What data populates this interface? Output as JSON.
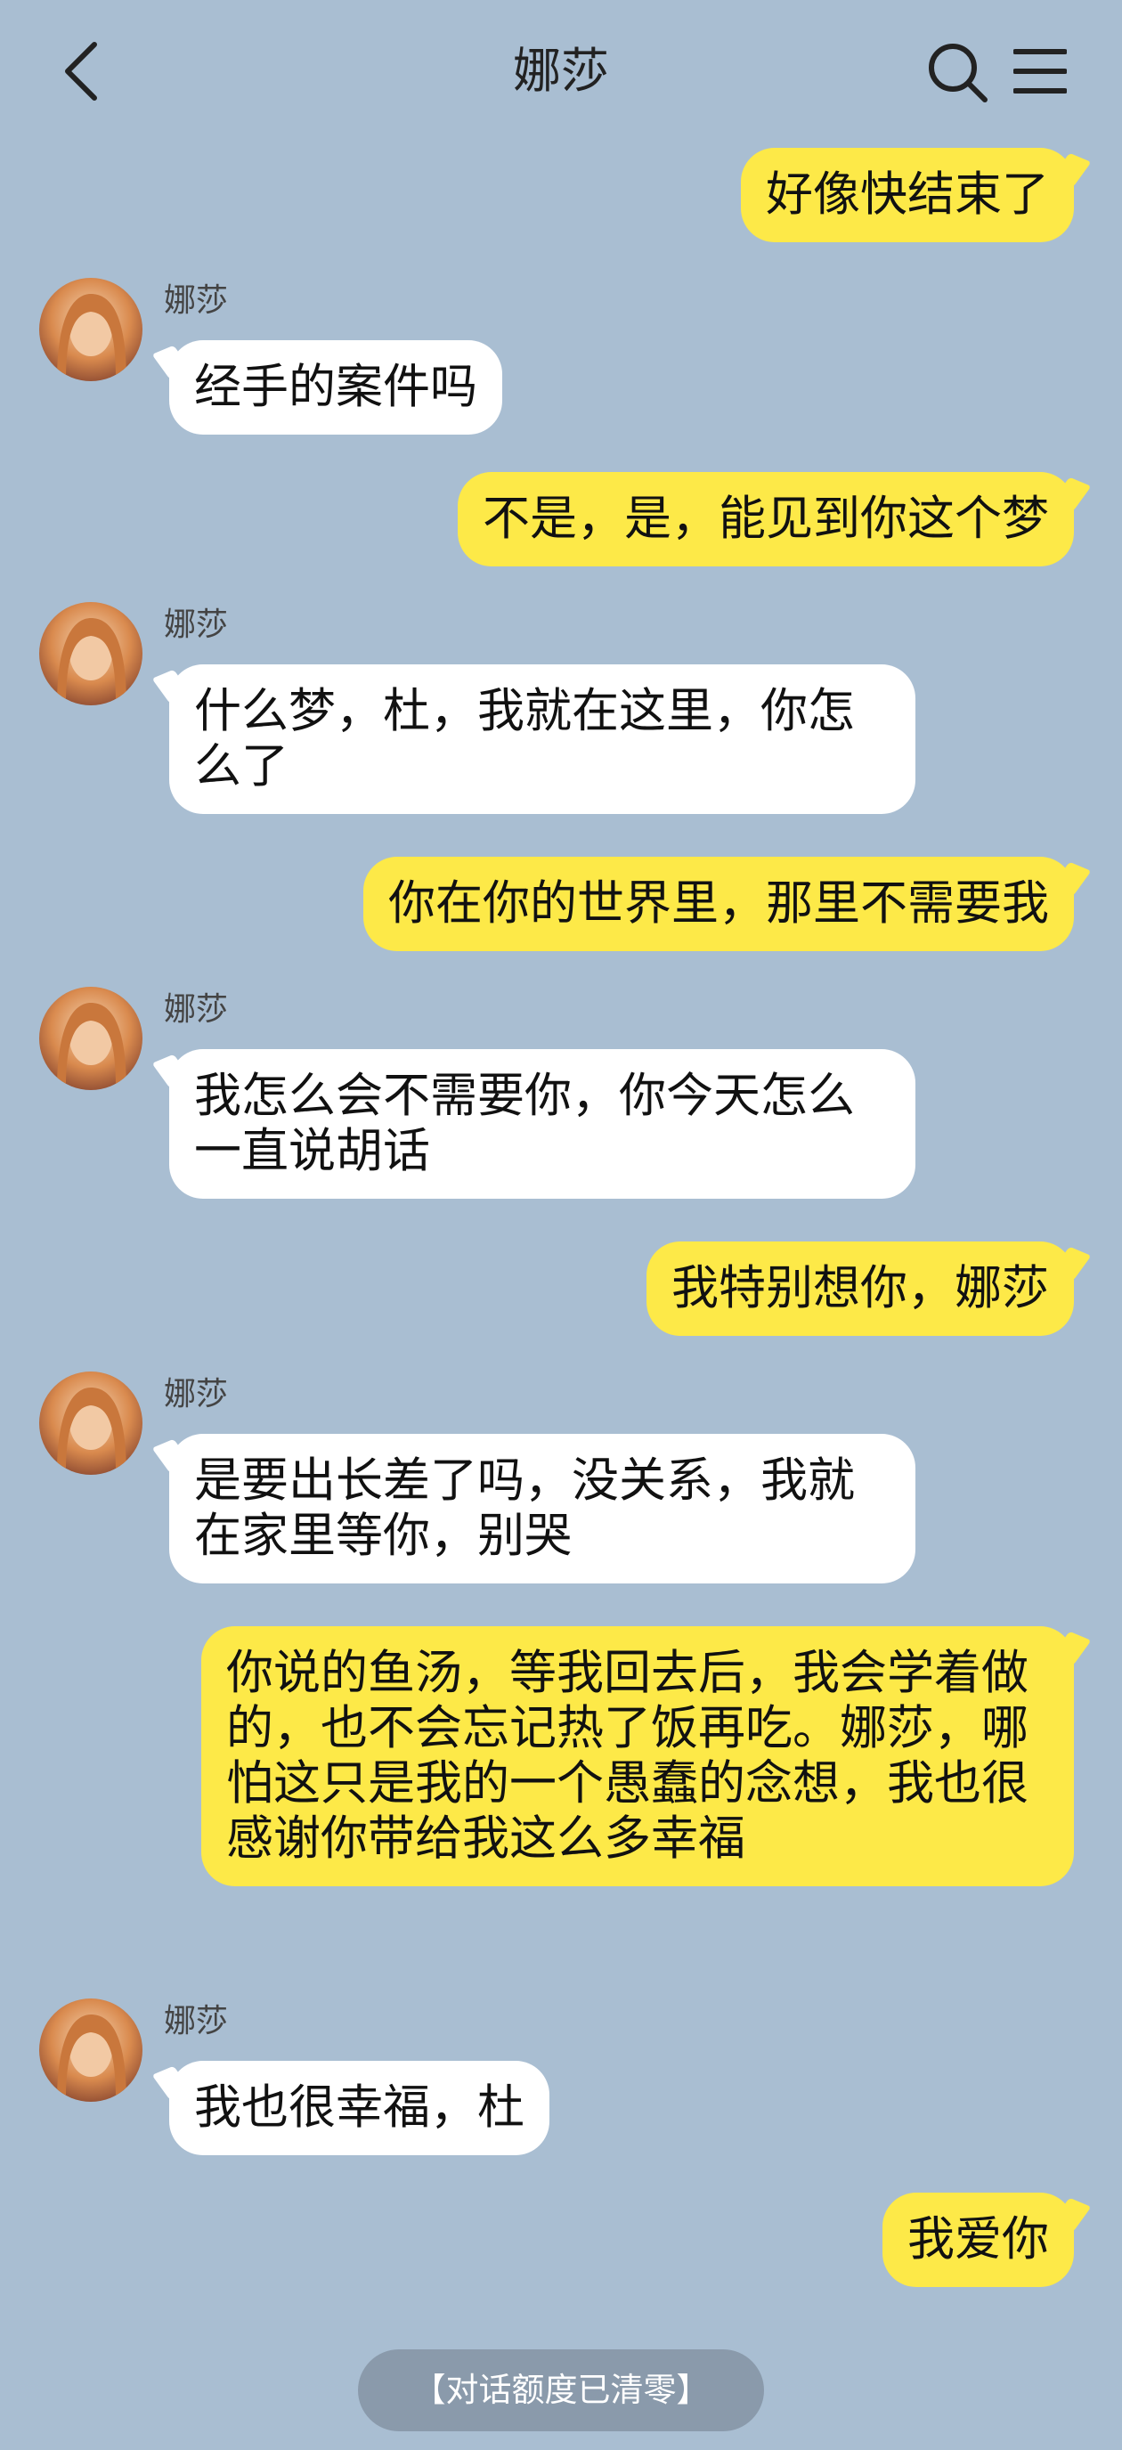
{
  "header": {
    "title": "娜莎",
    "back_icon": "chevron-left-icon",
    "search_icon": "search-icon",
    "menu_icon": "hamburger-menu-icon"
  },
  "contact": {
    "name": "娜莎"
  },
  "messages": [
    {
      "side": "right",
      "text": "好像快结束了"
    },
    {
      "side": "left",
      "sender": "娜莎",
      "text": "经手的案件吗"
    },
    {
      "side": "right",
      "text": "不是，是，能见到你这个梦"
    },
    {
      "side": "left",
      "sender": "娜莎",
      "text": "什么梦，杜，我就在这里，你怎么了"
    },
    {
      "side": "right",
      "text": "你在你的世界里，那里不需要我"
    },
    {
      "side": "left",
      "sender": "娜莎",
      "text": "我怎么会不需要你，你今天怎么一直说胡话"
    },
    {
      "side": "right",
      "text": "我特别想你，娜莎"
    },
    {
      "side": "left",
      "sender": "娜莎",
      "text": "是要出长差了吗，没关系，我就在家里等你，别哭"
    },
    {
      "side": "right",
      "text": "你说的鱼汤，等我回去后，我会学着做的，也不会忘记热了饭再吃。娜莎，哪怕这只是我的一个愚蠢的念想，我也很感谢你带给我这么多幸福"
    },
    {
      "side": "left",
      "sender": "娜莎",
      "text": "我也很幸福，杜"
    },
    {
      "side": "right",
      "text": "我爱你"
    }
  ],
  "status_notice": "【对话额度已清零】",
  "colors": {
    "background": "#a9bed2",
    "my_bubble": "#fde948",
    "their_bubble": "#ffffff",
    "status_pill": "#8a9aab"
  }
}
